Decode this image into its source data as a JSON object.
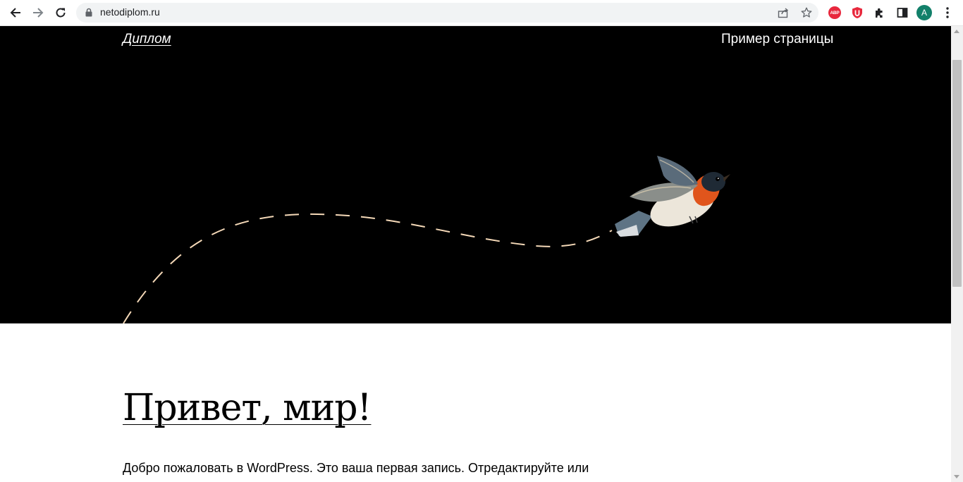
{
  "browser": {
    "url": "netodiplom.ru",
    "profile_initial": "A",
    "adblock_label": "ABP",
    "icons": [
      "back-icon",
      "forward-icon",
      "reload-icon",
      "lock-icon",
      "share-icon",
      "bookmark-star-icon",
      "adblock-icon",
      "ublock-icon",
      "extensions-puzzle-icon",
      "side-panel-icon",
      "profile-avatar",
      "menu-kebab-icon"
    ]
  },
  "site": {
    "title": "Диплом",
    "nav": [
      "Пример страницы"
    ]
  },
  "post": {
    "title": "Привет, мир!",
    "excerpt": "Добро пожаловать в WordPress. Это ваша первая запись. Отредактируйте или"
  },
  "colors": {
    "hero_bg": "#000000",
    "flight_path": "#f5d9b8",
    "avatar_bg": "#12806a",
    "abp_red": "#e8283d"
  }
}
